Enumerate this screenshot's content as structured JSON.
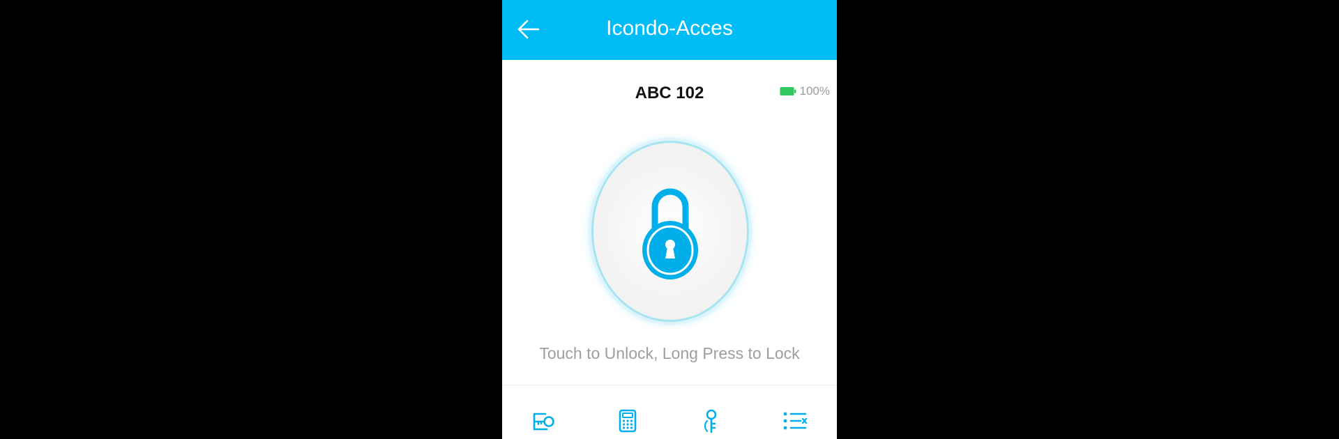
{
  "header": {
    "title": "Icondo-Acces",
    "back_icon": "arrow-left-icon",
    "background": "#00bcf4"
  },
  "device": {
    "name": "ABC 102",
    "battery_level": "100%",
    "battery_icon": "battery-full-icon",
    "battery_color": "#2fc862"
  },
  "lock": {
    "icon": "padlock-icon",
    "hint": "Touch to Unlock, Long Press to Lock",
    "accent": "#00bcf4"
  },
  "bottom_nav": [
    {
      "icon": "ekey-icon"
    },
    {
      "icon": "passcode-keypad-icon"
    },
    {
      "icon": "fingerprint-key-icon"
    },
    {
      "icon": "records-list-icon"
    }
  ]
}
